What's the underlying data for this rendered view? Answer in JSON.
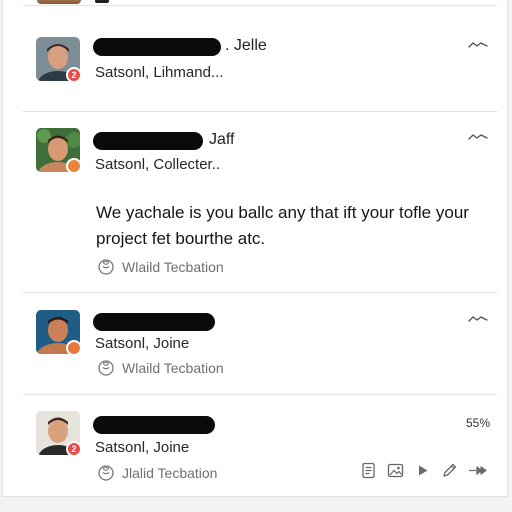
{
  "feed": {
    "posts": [
      {
        "name_suffix": ". Jelle",
        "subline": "Satsonl, Lihmand...",
        "has_badge": true,
        "badge": "2"
      },
      {
        "name_suffix": "Jaff",
        "subline": "Satsonl, Collecter..",
        "body": "We yachale is you ballc any that ift your tofle your project fet bourthe atc.",
        "reaction": "Wlaild Tecbation"
      },
      {
        "subline": "Satsonl, Joine",
        "reaction": "Wlaild Tecbation"
      },
      {
        "subline": "Satsonl, Joine",
        "reaction": "Jlalid Tecbation",
        "percent": "55%",
        "badge": "2"
      }
    ]
  },
  "icons": {
    "chevron": "wavy-chevron-icon",
    "reaction": "heart-smile-icon",
    "toolbar": [
      "document-icon",
      "image-icon",
      "play-icon",
      "pencil-icon",
      "forward-icon"
    ]
  },
  "colors": {
    "badge": "#ea4b47",
    "redaction": "#0b0b0b",
    "divider": "#e3e3e6"
  }
}
